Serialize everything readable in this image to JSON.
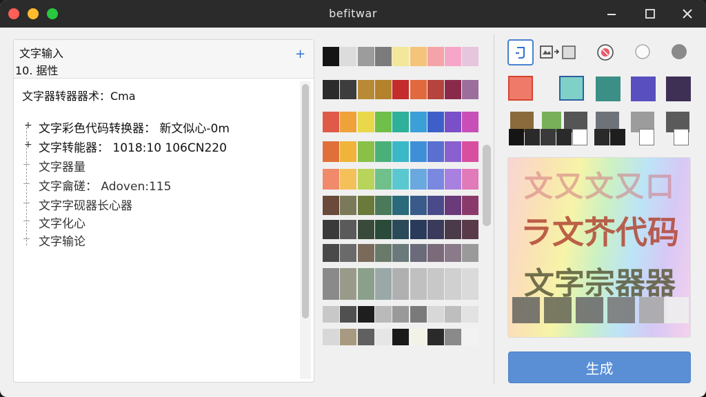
{
  "window": {
    "title": "befitwar"
  },
  "left_panel": {
    "title": "文字输入",
    "subtitle": "10. 据性",
    "summary": "文字器转器器术：Cma",
    "tree": [
      {
        "label": "文字彩色代码转换器： 新文似心-0m"
      },
      {
        "label": "文字转能器： 1018:10  106CN220"
      },
      {
        "label": "文字器量"
      },
      {
        "label": "文字龠磋： Adoven:115"
      },
      {
        "label": "文字字砚器长心器"
      },
      {
        "label": "文字化心"
      },
      {
        "label": "文字输论"
      }
    ]
  },
  "palette": {
    "rows": [
      [
        "#141414",
        "#dcdcdc",
        "#9c9c9c",
        "#7b7b7b",
        "#f2e79a",
        "#f4c47a",
        "#f4a4a8",
        "#f6a6c8",
        "#e6c6dc"
      ],
      [
        "#2b2b2b",
        "#3d3d3d",
        "#b98a36",
        "#b3822a",
        "#c42b2b",
        "#e0693d",
        "#b5443d",
        "#8a2a4a",
        "#9c6e9c"
      ],
      [
        "#e05a4a",
        "#f0a23a",
        "#e8d84a",
        "#6fc04a",
        "#2fb09a",
        "#3b9fd8",
        "#3f5fc8",
        "#7a4fc8",
        "#c84fb8"
      ],
      [
        "#e0703a",
        "#f0b43a",
        "#88c048",
        "#4ab07a",
        "#3ab8c8",
        "#3f8fd8",
        "#5a6fd0",
        "#8a60d0",
        "#d84fa0"
      ],
      [
        "#f08a6a",
        "#f4c05a",
        "#b8d45a",
        "#6fc08a",
        "#5ac8d0",
        "#6aa8e0",
        "#7a88e0",
        "#a880e0",
        "#e07ab8"
      ],
      [
        "#6a4a3a",
        "#7a7a5a",
        "#6a7a3a",
        "#4a7a5a",
        "#2a6a7a",
        "#3a5a8a",
        "#4a4a8a",
        "#6a3a7a",
        "#8a3a6a"
      ],
      [
        "#3a3a3a",
        "#5a5a5a",
        "#3a4a3a",
        "#2a4a3a",
        "#2a4a5a",
        "#2a3a5a",
        "#3a3a5a",
        "#4a3a4a",
        "#5a3a4a"
      ],
      [
        "#4a4a4a",
        "#6a6a6a",
        "#7a6a5a",
        "#6a7a6a",
        "#6a7a7a",
        "#6a6a7a",
        "#7a6a7a",
        "#8a7a8a",
        "#9a9a9a"
      ],
      [
        "#8a8a8a",
        "#9a9a8a",
        "#8aa08a",
        "#9aa8a8",
        "#b0b0b0",
        "#c0c0c0",
        "#c8c8c8",
        "#d0d0d0",
        "#dadada"
      ],
      [
        "#c8c8c8",
        "#505050",
        "#1e1e1e",
        "#bababa",
        "#9a9a9a",
        "#7a7a7a",
        "#d8d8d8",
        "#bebebe",
        "#e2e2e2"
      ],
      [
        "#d8d8d8",
        "#a89a80",
        "#606060",
        "#e6e6e6",
        "#1a1a1a",
        "#f2f2e6",
        "#2a2a2a",
        "#8a8a8a",
        "#f2f2f2"
      ]
    ]
  },
  "right_panel": {
    "big_swatches": [
      "#f07a6a",
      "#7fd1c8",
      "#3c8f86",
      "#5a4fbf",
      "#3e3055"
    ],
    "mid_swatches": [
      "#8a6a3a",
      "#78b05a",
      "#555555",
      "#6e737a",
      "#9c9c9c",
      "#5a5a5a"
    ],
    "mini_swatches": [
      "#151515",
      "#2a2a2a",
      "#3a3a3a",
      "#2a2a2a",
      "#ffffff",
      "#2a2a2a",
      "#1e1e1e",
      "#ffffff"
    ],
    "preview": {
      "line1": "文又文又口",
      "line2": "ラ文芥代码",
      "line3": "文字宗器器",
      "swatches": [
        "#6a6a66",
        "#6c6c5a",
        "#6e6e6e",
        "#7a7a7a",
        "#a8a8a8",
        "#eeeeee"
      ]
    },
    "generate_label": "生成"
  }
}
